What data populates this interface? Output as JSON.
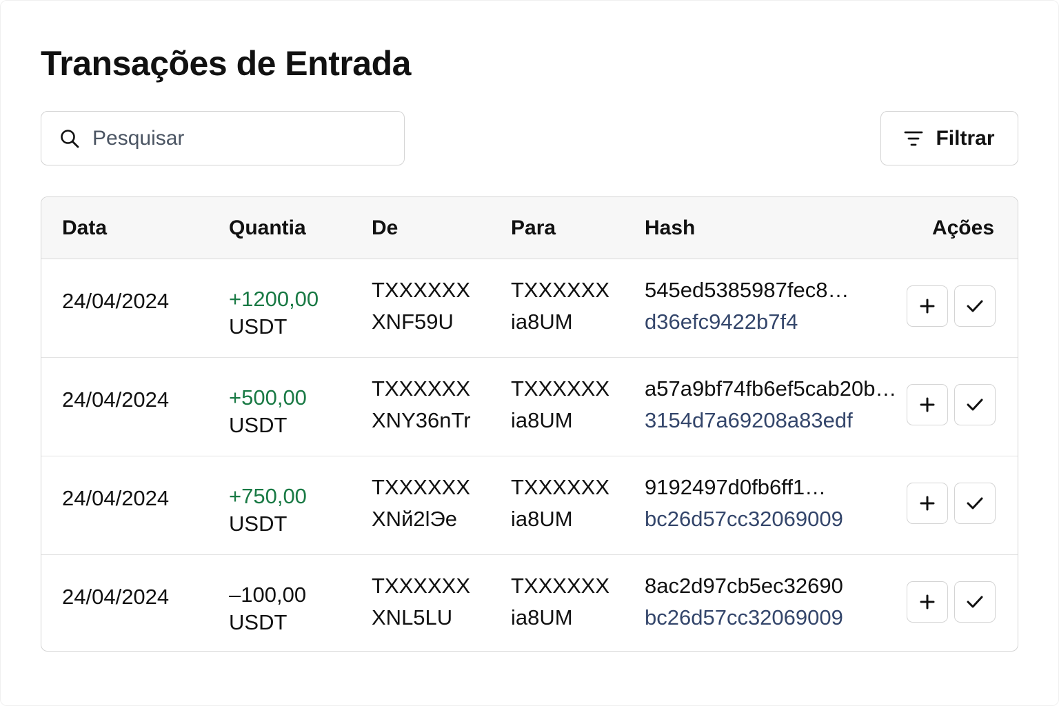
{
  "page": {
    "title": "Transações de Entrada"
  },
  "search": {
    "placeholder": "Pesquisar",
    "icon": "search-icon"
  },
  "filter": {
    "label": "Filtrar",
    "icon": "filter-lines-icon"
  },
  "table": {
    "headers": {
      "date": "Data",
      "amount": "Quantia",
      "from": "De",
      "to": "Para",
      "hash": "Hash",
      "actions": "Ações"
    },
    "rows": [
      {
        "date": "24/04/2024",
        "amount": "+1200,00",
        "amount_sign": "positive",
        "unit": "USDT",
        "from_line1": "TXXXXXX",
        "from_line2": "XNF59U",
        "to_line1": "TXXXXXX",
        "to_line2": "ia8UM",
        "hash_line1": "545ed5385987fec8…",
        "hash_line2": "d36efc9422b7f4"
      },
      {
        "date": "24/04/2024",
        "amount": "+500,00",
        "amount_sign": "positive",
        "unit": "USDT",
        "from_line1": "TXXXXXX",
        "from_line2": "XNY36nTr",
        "to_line1": "TXXXXXX",
        "to_line2": "ia8UM",
        "hash_line1": "a57a9bf74fb6ef5cab20b…",
        "hash_line2": "3154d7a69208a83edf"
      },
      {
        "date": "24/04/2024",
        "amount": "+750,00",
        "amount_sign": "positive",
        "unit": "USDT",
        "from_line1": "TXXXXXX",
        "from_line2": "XNй2lЭe",
        "to_line1": "TXXXXXX",
        "to_line2": "ia8UM",
        "hash_line1": "9192497d0fb6ff1…",
        "hash_line2": "bc26d57cc32069009"
      },
      {
        "date": "24/04/2024",
        "amount": "–100,00",
        "amount_sign": "negative",
        "unit": "USDT",
        "from_line1": "TXXXXXX",
        "from_line2": "XNL5LU",
        "to_line1": "TXXXXXX",
        "to_line2": "ia8UM",
        "hash_line1": "8ac2d97cb5ec32690",
        "hash_line2": "bc26d57cc32069009"
      }
    ],
    "row_actions": [
      {
        "icon": "plus-icon"
      },
      {
        "icon": "check-icon"
      }
    ]
  },
  "colors": {
    "positive_amount": "#1a7a45",
    "hash_secondary": "#34466b",
    "border": "#d4d4d4",
    "header_bg": "#f7f7f7"
  }
}
